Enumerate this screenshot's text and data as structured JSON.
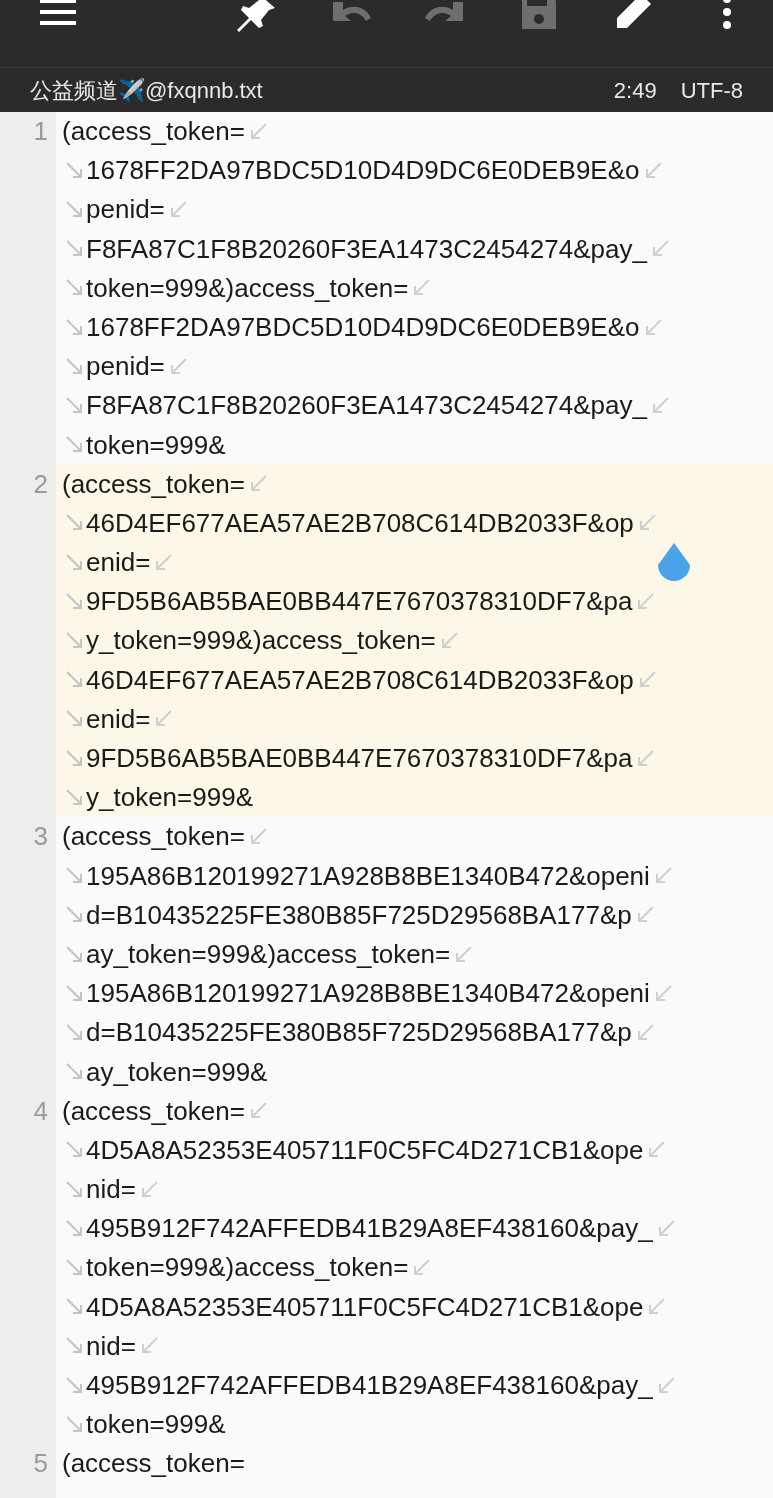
{
  "toolbar": {
    "buttons": [
      {
        "kind": "menu",
        "disabled": false
      },
      {
        "kind": "pin",
        "disabled": false
      },
      {
        "kind": "undo",
        "disabled": true
      },
      {
        "kind": "redo",
        "disabled": true
      },
      {
        "kind": "save",
        "disabled": true
      },
      {
        "kind": "edit",
        "disabled": false
      },
      {
        "kind": "more",
        "disabled": false
      }
    ]
  },
  "status_bar": {
    "filename": "公益频道✈️@fxqnnb.txt",
    "cursor": "2:49",
    "encoding": "UTF-8"
  },
  "lines": [
    {
      "number": "1",
      "current": false,
      "rows": [
        "(access_token=",
        "1678FF2DA97BDC5D10D4D9DC6E0DEB9E&o",
        "penid=",
        "F8FA87C1F8B20260F3EA1473C2454274&pay_",
        "token=999&)access_token=",
        "1678FF2DA97BDC5D10D4D9DC6E0DEB9E&o",
        "penid=",
        "F8FA87C1F8B20260F3EA1473C2454274&pay_",
        "token=999&"
      ]
    },
    {
      "number": "2",
      "current": true,
      "rows": [
        "(access_token=",
        "46D4EF677AEA57AE2B708C614DB2033F&op",
        "enid=",
        "9FD5B6AB5BAE0BB447E7670378310DF7&pa",
        "y_token=999&)access_token=",
        "46D4EF677AEA57AE2B708C614DB2033F&op",
        "enid=",
        "9FD5B6AB5BAE0BB447E7670378310DF7&pa",
        "y_token=999&"
      ]
    },
    {
      "number": "3",
      "current": false,
      "rows": [
        "(access_token=",
        "195A86B120199271A928B8BE1340B472&openi",
        "d=B10435225FE380B85F725D29568BA177&p",
        "ay_token=999&)access_token=",
        "195A86B120199271A928B8BE1340B472&openi",
        "d=B10435225FE380B85F725D29568BA177&p",
        "ay_token=999&"
      ]
    },
    {
      "number": "4",
      "current": false,
      "rows": [
        "(access_token=",
        "4D5A8A52353E405711F0C5FC4D271CB1&ope",
        "nid=",
        "495B912F742AFFEDB41B29A8EF438160&pay_",
        "token=999&)access_token=",
        "4D5A8A52353E405711F0C5FC4D271CB1&ope",
        "nid=",
        "495B912F742AFFEDB41B29A8EF438160&pay_",
        "token=999&"
      ]
    },
    {
      "number": "5",
      "current": false,
      "rows": [
        "(access_token="
      ]
    }
  ]
}
